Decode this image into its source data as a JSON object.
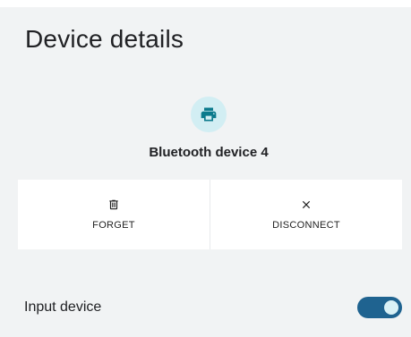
{
  "page": {
    "title": "Device details"
  },
  "device": {
    "name": "Bluetooth device 4",
    "icon": "printer-icon",
    "icon_bg": "#d2eef3",
    "icon_color": "#0b7a8c"
  },
  "actions": [
    {
      "label": "FORGET",
      "icon": "trash-icon"
    },
    {
      "label": "DISCONNECT",
      "icon": "close-icon"
    }
  ],
  "settings": {
    "input_device": {
      "label": "Input device",
      "enabled": true,
      "toggle_color": "#1f6390"
    }
  }
}
